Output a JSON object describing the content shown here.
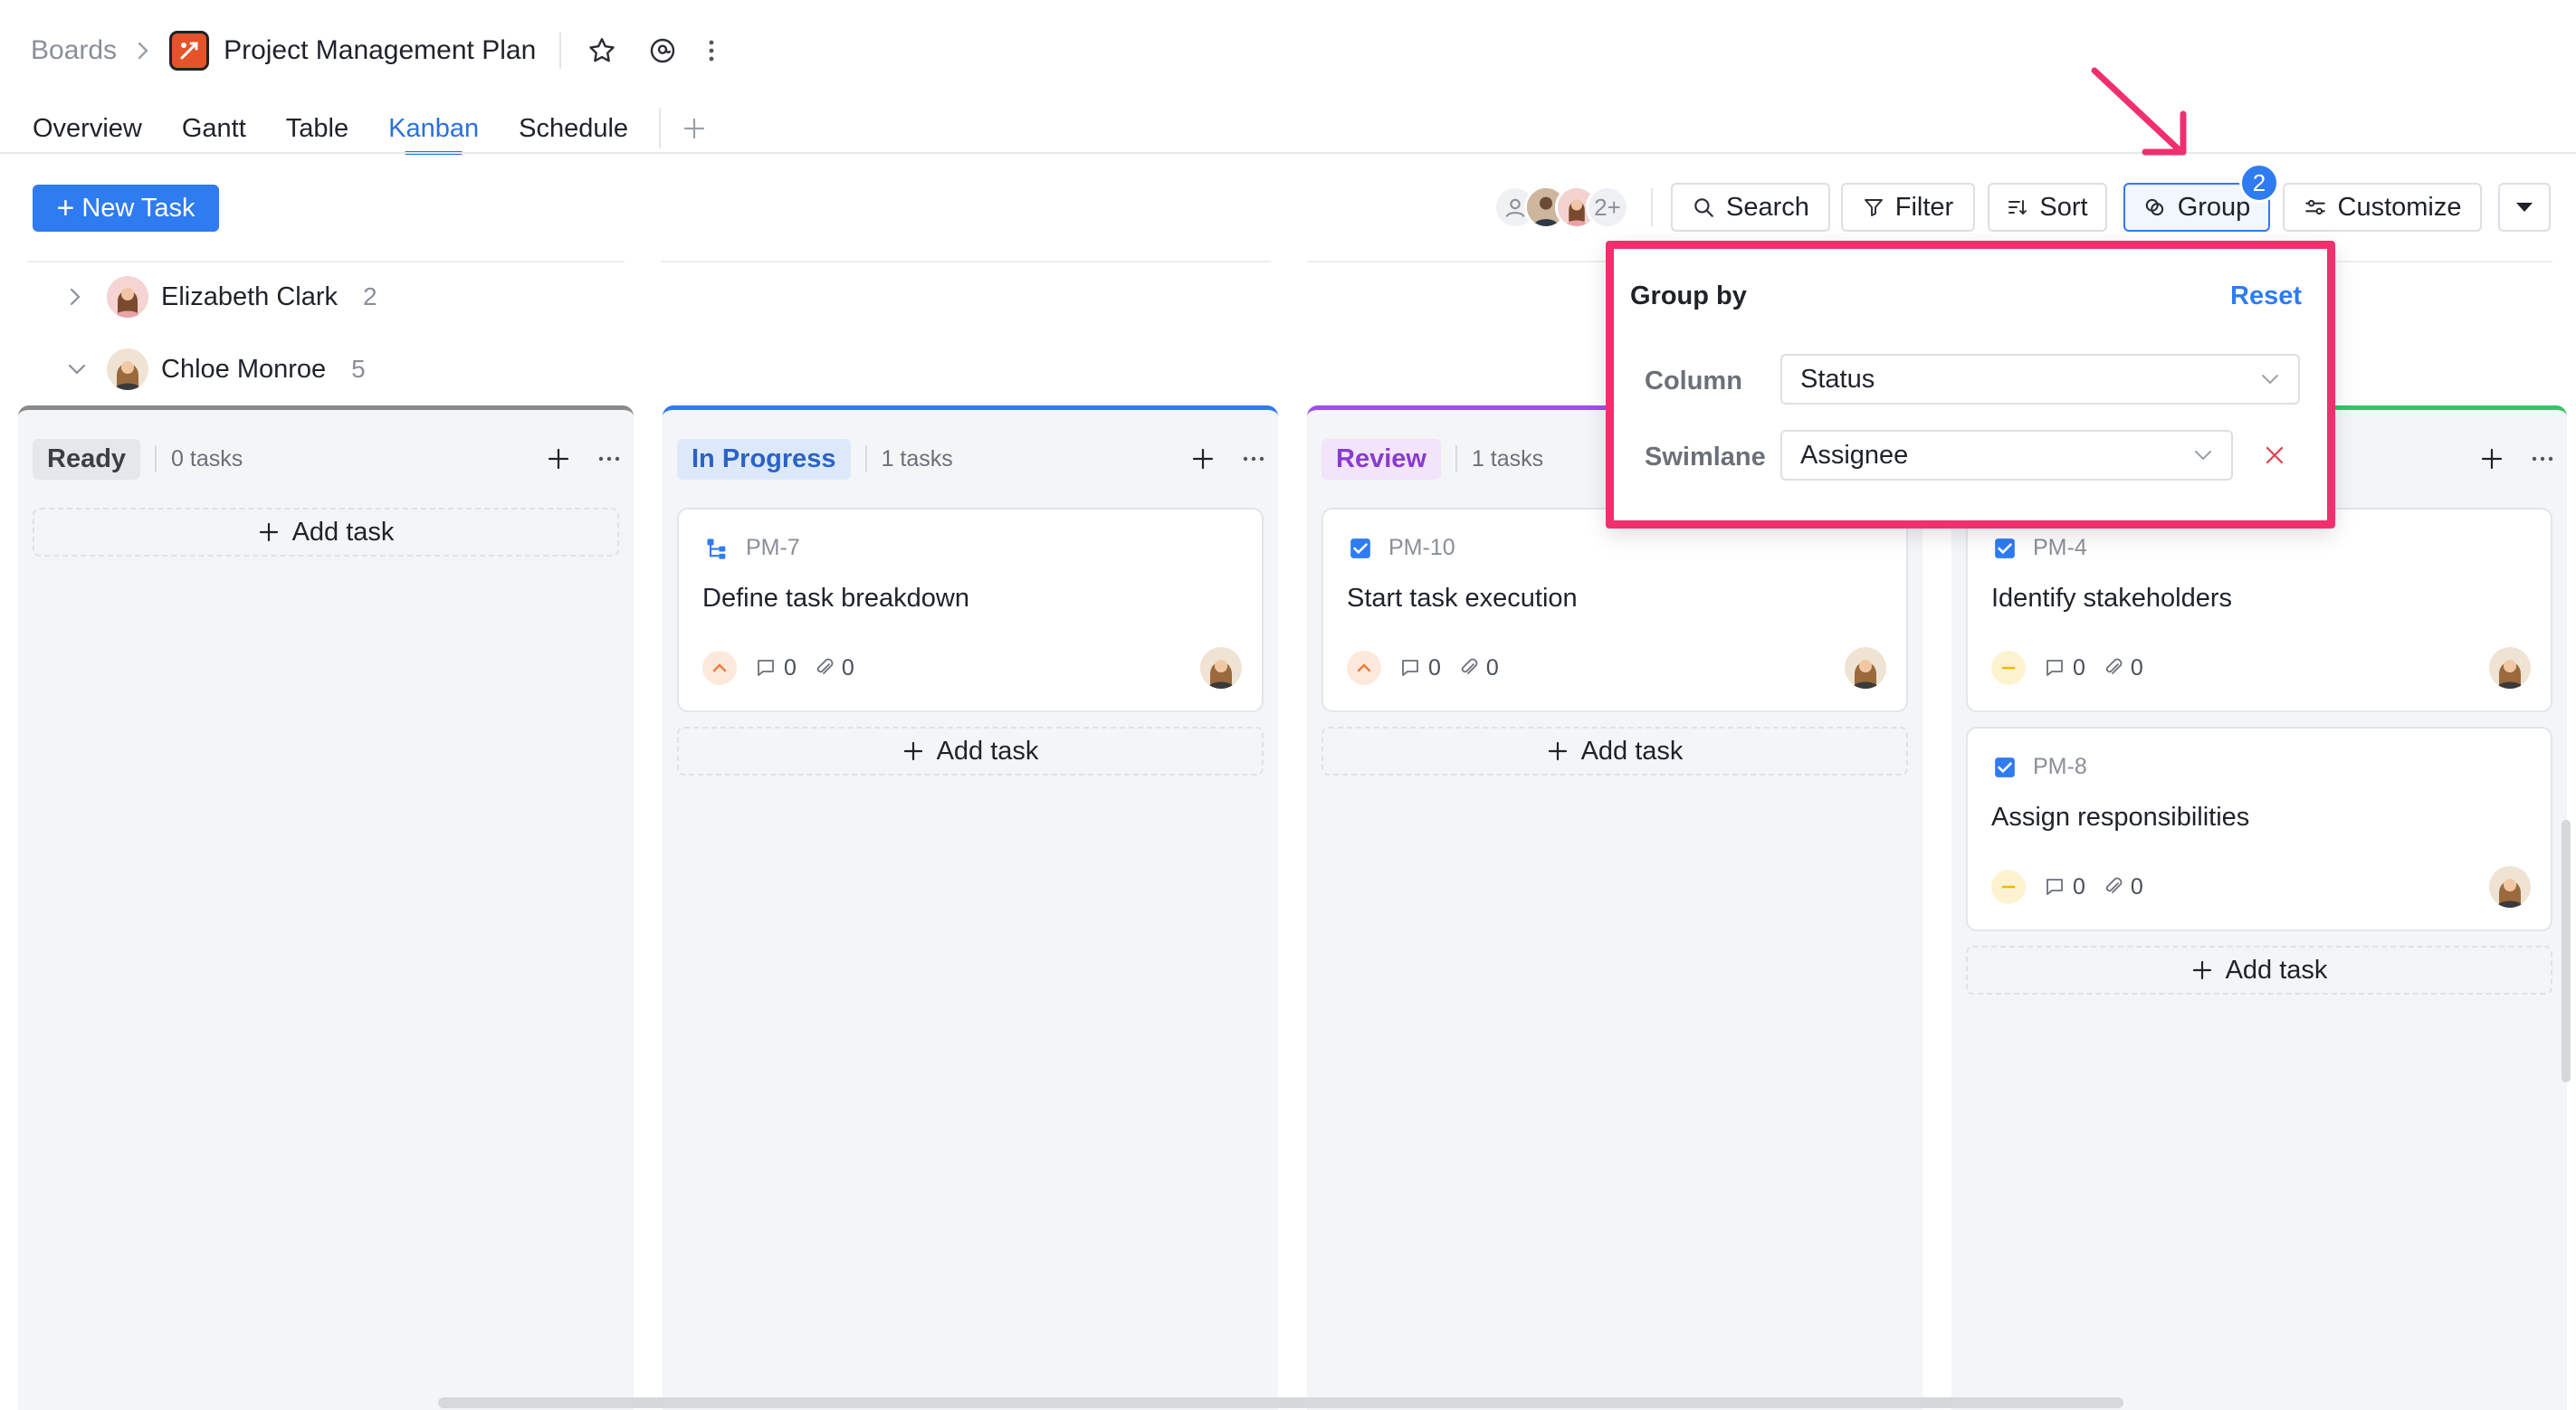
{
  "header": {
    "breadcrumb_root": "Boards",
    "project_title": "Project Management Plan"
  },
  "tabs": [
    {
      "label": "Overview"
    },
    {
      "label": "Gantt"
    },
    {
      "label": "Table"
    },
    {
      "label": "Kanban",
      "active": true
    },
    {
      "label": "Schedule"
    }
  ],
  "toolbar": {
    "new_task": "New Task",
    "avatars_more": "2+",
    "search": "Search",
    "filter": "Filter",
    "sort": "Sort",
    "group": "Group",
    "group_badge": "2",
    "customize": "Customize"
  },
  "swimlanes": [
    {
      "name": "Elizabeth Clark",
      "count": "2",
      "expanded": false
    },
    {
      "name": "Chloe Monroe",
      "count": "5",
      "expanded": true
    }
  ],
  "columns": [
    {
      "title": "Ready",
      "count": "0 tasks",
      "color": "#8a8a8a",
      "title_bg": "#e6e7ea",
      "title_color": "#3b3f45",
      "cards": [],
      "add_task": "Add task"
    },
    {
      "title": "In Progress",
      "count": "1 tasks",
      "color": "#2f7bf0",
      "title_bg": "#dde9fb",
      "title_color": "#2b63c7",
      "cards": [
        {
          "id": "PM-7",
          "title": "Define task breakdown",
          "comments": "0",
          "attachments": "0",
          "priority": "high",
          "type": "subtask"
        }
      ],
      "add_task": "Add task"
    },
    {
      "title": "Review",
      "count": "1 tasks",
      "color": "#a14ee8",
      "title_bg": "#f1e4fb",
      "title_color": "#8a3ad0",
      "cards": [
        {
          "id": "PM-10",
          "title": "Start task execution",
          "comments": "0",
          "attachments": "0",
          "priority": "high",
          "type": "task"
        }
      ],
      "add_task": "Add task"
    },
    {
      "title": "",
      "count": "",
      "color": "#34c46a",
      "title_bg": "#fff",
      "title_color": "#1f2329",
      "cards": [
        {
          "id": "PM-4",
          "title": "Identify stakeholders",
          "comments": "0",
          "attachments": "0",
          "priority": "medium",
          "type": "task"
        },
        {
          "id": "PM-8",
          "title": "Assign responsibilities",
          "comments": "0",
          "attachments": "0",
          "priority": "medium",
          "type": "task"
        }
      ],
      "add_task": "Add task"
    }
  ],
  "group_popover": {
    "title": "Group by",
    "reset": "Reset",
    "column_label": "Column",
    "column_value": "Status",
    "swimlane_label": "Swimlane",
    "swimlane_value": "Assignee"
  },
  "colors": {
    "accent": "#2f7bf0",
    "highlight": "#f0306e",
    "priority_high": "#f07a3a",
    "priority_medium": "#f2b705"
  }
}
